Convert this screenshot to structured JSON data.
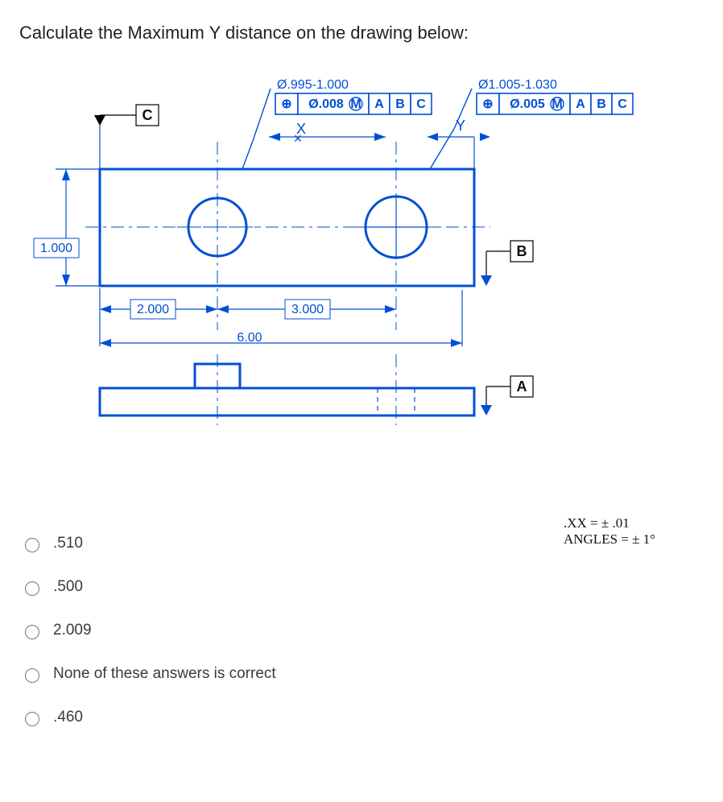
{
  "question": "Calculate the Maximum Y distance on the drawing below:",
  "drawing": {
    "datums": {
      "A": "A",
      "B": "B",
      "C": "C"
    },
    "dims": {
      "height": "1.000",
      "hole_x": "2.000",
      "hole_pitch": "3.000",
      "overall": "6.00",
      "x_label": "X",
      "y_label": "Y"
    },
    "callouts": {
      "hole1_dia": "Ø.995-1.000",
      "hole2_dia": "Ø1.005-1.030"
    },
    "fcf1": {
      "sym": "⊕",
      "tol": "Ø.008",
      "mat": "M",
      "A": "A",
      "B": "B",
      "C": "C"
    },
    "fcf2": {
      "sym": "⊕",
      "tol": "Ø.005",
      "mat": "M",
      "A": "A",
      "B": "B",
      "C": "C"
    }
  },
  "tolerance_notes": {
    "line1": ".XX  = ± .01",
    "line2": "ANGLES = ±  1°"
  },
  "options": {
    "a": ".510",
    "b": ".500",
    "c": "2.009",
    "d": "None of these answers is correct",
    "e": ".460"
  }
}
